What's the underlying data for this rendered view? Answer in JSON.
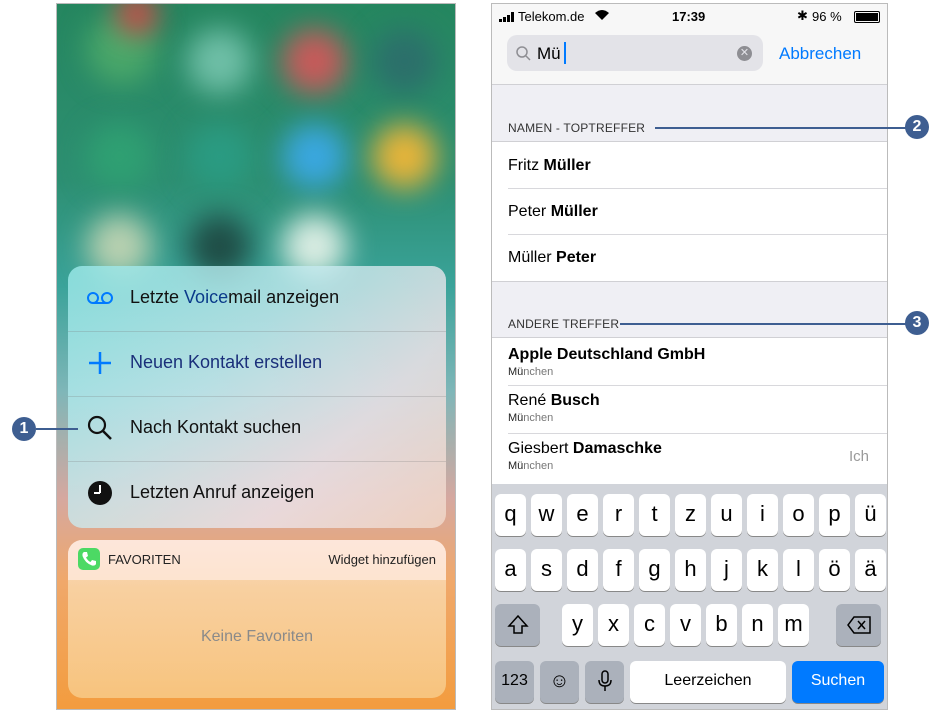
{
  "left_phone": {
    "menu": [
      {
        "icon": "voicemail-icon",
        "label_prefix": "Letzte ",
        "label_highlight": "Voice",
        "label_suffix": "mail anzeigen"
      },
      {
        "icon": "plus-icon",
        "label": "Neuen Kontakt erstellen"
      },
      {
        "icon": "search-icon",
        "label": "Nach Kontakt suchen"
      },
      {
        "icon": "clock-icon",
        "label": "Letzten Anruf anzeigen"
      }
    ],
    "favorites_widget": {
      "title": "FAVORITEN",
      "action": "Widget hinzufügen",
      "empty_text": "Keine Favoriten"
    }
  },
  "right_phone": {
    "status_bar": {
      "carrier": "Telekom.de",
      "time": "17:39",
      "battery": "96 %"
    },
    "search": {
      "value": "Mü",
      "cancel_label": "Abbrechen"
    },
    "sections": [
      {
        "header": "NAMEN - TOPTREFFER",
        "results": [
          {
            "first": "Fritz ",
            "last": "Müller"
          },
          {
            "first": "Peter ",
            "last": "Müller"
          },
          {
            "first": "Müller ",
            "last": "Peter"
          }
        ]
      },
      {
        "header": "ANDERE TREFFER",
        "results": [
          {
            "first": "",
            "last": "Apple Deutschland GmbH",
            "sub_match": "Mü",
            "sub_rest": "nchen",
            "badge": ""
          },
          {
            "first": "René ",
            "last": "Busch",
            "sub_match": "Mü",
            "sub_rest": "nchen",
            "badge": ""
          },
          {
            "first": "Giesbert ",
            "last": "Damaschke",
            "sub_match": "Mü",
            "sub_rest": "nchen",
            "badge": "Ich"
          }
        ]
      }
    ],
    "keyboard": {
      "row1": [
        "q",
        "w",
        "e",
        "r",
        "t",
        "z",
        "u",
        "i",
        "o",
        "p",
        "ü"
      ],
      "row2": [
        "a",
        "s",
        "d",
        "f",
        "g",
        "h",
        "j",
        "k",
        "l",
        "ö",
        "ä"
      ],
      "row3": [
        "y",
        "x",
        "c",
        "v",
        "b",
        "n",
        "m"
      ],
      "numbers_key": "123",
      "space_key": "Leerzeichen",
      "search_key": "Suchen"
    }
  },
  "callouts": [
    "1",
    "2",
    "3"
  ],
  "colors": {
    "ios_blue": "#007aff",
    "callout_blue": "#3e5e91",
    "phone_green": "#4cd964"
  }
}
